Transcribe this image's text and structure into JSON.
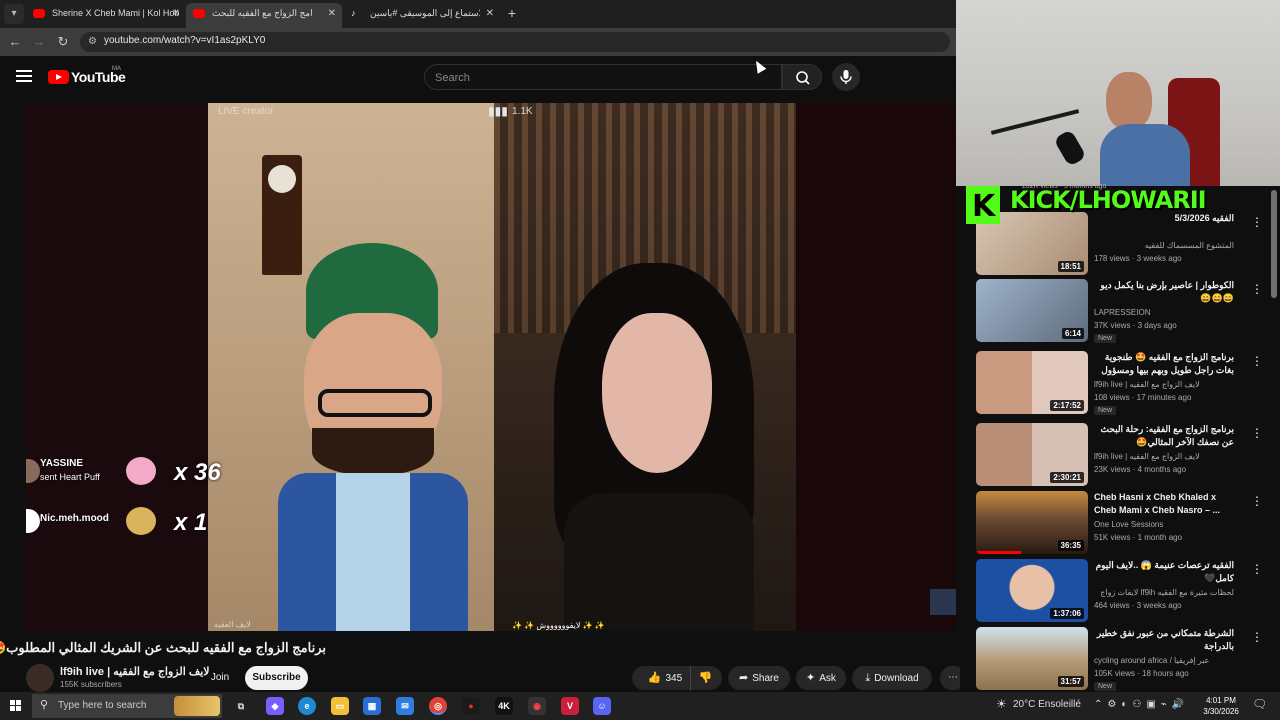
{
  "browser": {
    "tabs": [
      {
        "label": "Sherine X Cheb Mami | Kol Hob",
        "icon": "youtube-icon",
        "active": false
      },
      {
        "label": "برنامج الزواج مع الفقيه للبحث",
        "icon": "youtube-icon",
        "active": true
      },
      {
        "label": "الاستماع إلى الموسيقى #ياسين...",
        "icon": "tiktok-icon",
        "active": false
      }
    ],
    "url": "youtube.com/watch?v=vI1as2pKLY0"
  },
  "youtube": {
    "logo_text": "YouTube",
    "country_code": "MA",
    "search_placeholder": "Search"
  },
  "video": {
    "overlay_live_creator": "LIVE creator",
    "overlay_viewers": "1.1K",
    "gifts": [
      {
        "user": "YASSINE",
        "action": "sent Heart Puff",
        "count": "x 36"
      },
      {
        "user": "Nic.meh.mood",
        "action": "",
        "count": "x 1"
      }
    ],
    "footer_left": "لايف الفقيه",
    "footer_right": "✨ ✨ لايفووووووش ✨ ✨",
    "title": "برنامج الزواج مع الفقيه للبحث عن الشريك المثالي المطلوب🤩",
    "channel_name": "lf9ih live | لايف الزواج مع الفقيه",
    "subscribers": "155K subscribers",
    "join_label": "Join",
    "subscribe_label": "Subscribe",
    "likes": "345",
    "share_label": "Share",
    "ask_label": "Ask",
    "download_label": "Download"
  },
  "overlay": {
    "kick_text": "KICK/LHOWARII"
  },
  "sidebar": {
    "partial_top": "202K views · 5 months ago",
    "items": [
      {
        "title": "الفقيه 5/3/2026",
        "channel": "المتشوع المسسماك للفقيه",
        "meta": "178 views · 3 weeks ago",
        "duration": "18:51",
        "badge": "",
        "thumb_color": "#c9b5a0"
      },
      {
        "title": "الكوطوار | عاصير بإرض بنا يكمل ديو 😄😄😄",
        "channel": "LAPRESSEION",
        "meta": "37K views · 3 days ago",
        "duration": "6:14",
        "badge": "New",
        "thumb_color": "#8a9cb0"
      },
      {
        "title": "برنامج الزواج مع الفقيه 🤩 طنجوية بغات راجل طويل وبهم بيها ومسؤول الزواج‼️",
        "channel": "lf9ih live | لايف الزواج مع الفقيه",
        "meta": "108 views · 17 minutes ago",
        "duration": "2:17:52",
        "badge": "New",
        "thumb_color": "#c99a80"
      },
      {
        "title": "برنامج الزواج مع الفقيه: رحلة البحث عن نصفك الآخر المثالي🤩",
        "channel": "lf9ih live | لايف الزواج مع الفقيه",
        "meta": "23K views · 4 months ago",
        "duration": "2:30:21",
        "badge": "",
        "thumb_color": "#b98f78"
      },
      {
        "title": "Cheb Hasni x Cheb Khaled x Cheb Mami x Cheb Nasro – ...",
        "channel": "One Love Sessions",
        "meta": "51K views · 1 month ago",
        "duration": "36:35",
        "badge": "",
        "thumb_color": "#6a4a32"
      },
      {
        "title": "الفقيه ترعصات عنيمة 😱 ..لايف اليوم كامل🖤",
        "channel": "لحظات مثيرة مع الفقيه lf9ih لايفات زواج",
        "meta": "464 views · 3 weeks ago",
        "duration": "1:37:06",
        "badge": "",
        "thumb_color": "#1d4fa3"
      },
      {
        "title": "الشرطة متمكاني من عبور نفق خطير بالدراجة",
        "channel": "cycling around africa / عبر إفريقيا",
        "meta": "105K views · 18 hours ago",
        "duration": "31:57",
        "badge": "New",
        "thumb_color": "#b49a72"
      }
    ]
  },
  "taskbar": {
    "search_placeholder": "Type here to search",
    "weather": "20°C  Ensoleillé",
    "time": "4:01 PM",
    "date": "3/30/2026"
  }
}
